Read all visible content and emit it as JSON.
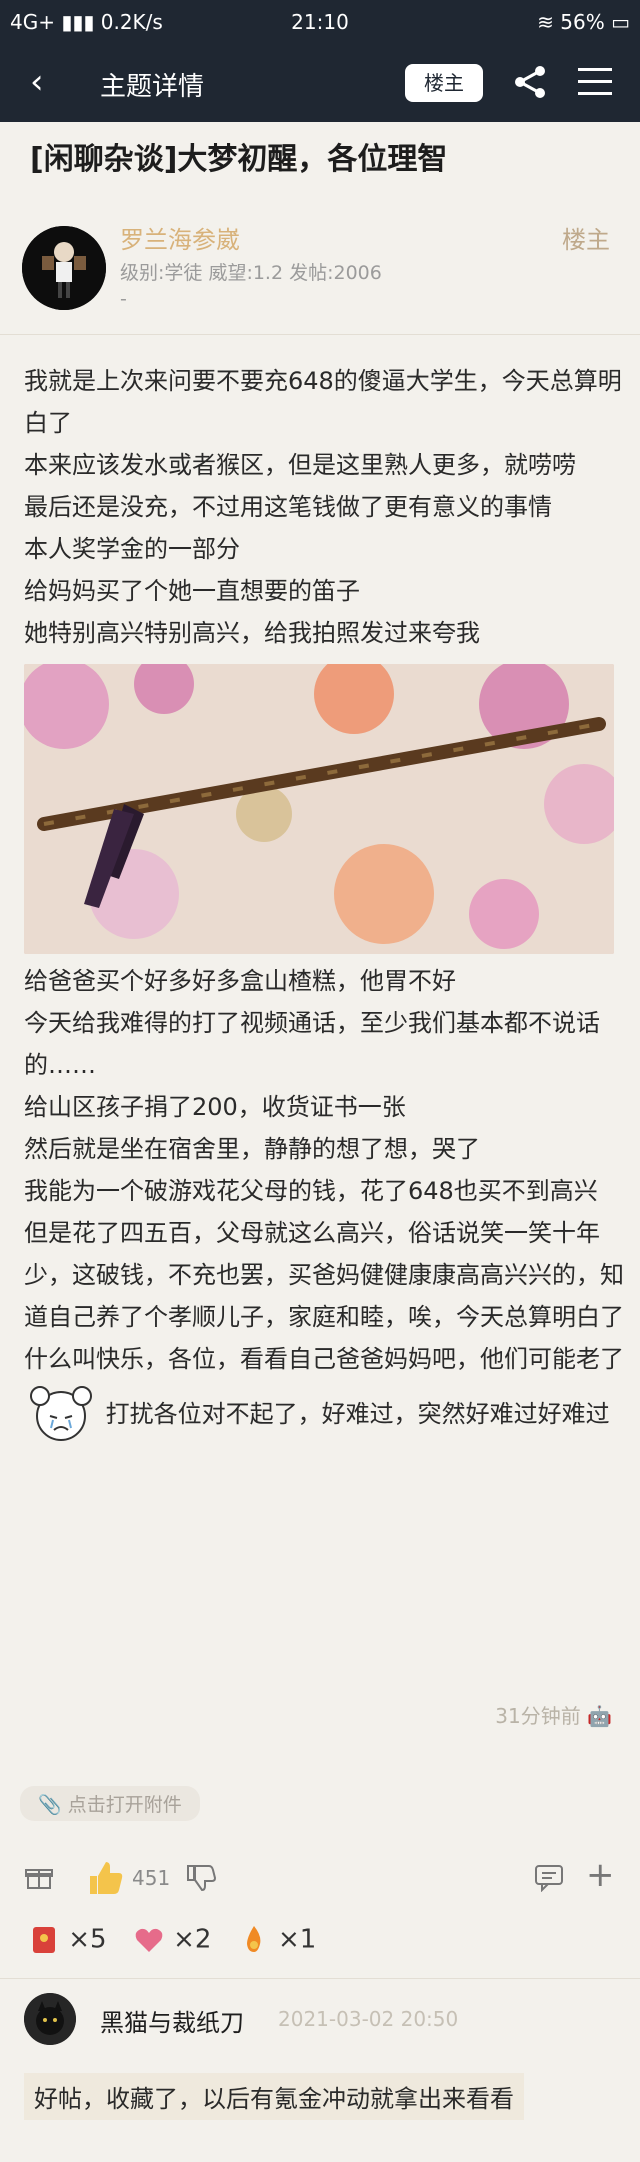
{
  "status": {
    "network": "4G+",
    "speed": "0.2K/s",
    "time": "21:10",
    "battery": "56%"
  },
  "appbar": {
    "title": "主题详情",
    "op_button": "楼主"
  },
  "thread": {
    "title": "[闲聊杂谈]大梦初醒，各位理智"
  },
  "author": {
    "name": "罗兰海参崴",
    "meta": "级别:学徒 威望:1.2 发帖:2006",
    "dash": "-",
    "op_label": "楼主"
  },
  "post": {
    "paragraphs": [
      "我就是上次来问要不要充648的傻逼大学生，今天总算明白了",
      "本来应该发水或者猴区，但是这里熟人更多，就唠唠",
      "最后还是没充，不过用这笔钱做了更有意义的事情",
      "本人奖学金的一部分",
      "给妈妈买了个她一直想要的笛子",
      "她特别高兴特别高兴，给我拍照发过来夸我"
    ],
    "paragraphs_after": [
      "给爸爸买个好多好多盒山楂糕，他胃不好",
      "今天给我难得的打了视频通话，至少我们基本都不说话的……",
      "给山区孩子捐了200，收货证书一张",
      "然后就是坐在宿舍里，静静的想了想，哭了",
      "我能为一个破游戏花父母的钱，花了648也买不到高兴",
      "但是花了四五百，父母就这么高兴，俗话说笑一笑十年少，这破钱，不充也罢，买爸妈健健康康高高兴兴的，知道自己养了个孝顺儿子，家庭和睦，唉，今天总算明白了"
    ],
    "last_before": "什么叫快乐，各位，看看自己爸爸妈妈吧，他们可能老了",
    "last_after": "打扰各位对不起了，好难过，突然好难过好难过",
    "time": "31分钟前"
  },
  "attachment": {
    "label": "点击打开附件"
  },
  "actions": {
    "likes": "451"
  },
  "gifts": [
    {
      "icon": "red-envelope-gift-icon",
      "count": "×5"
    },
    {
      "icon": "heart-gift-icon",
      "count": "×2"
    },
    {
      "icon": "flame-gift-icon",
      "count": "×1"
    }
  ],
  "reply": {
    "name": "黑猫与裁纸刀",
    "time": "2021-03-02 20:50",
    "text": "好帖，收藏了，以后有氪金冲动就拿出来看看"
  }
}
